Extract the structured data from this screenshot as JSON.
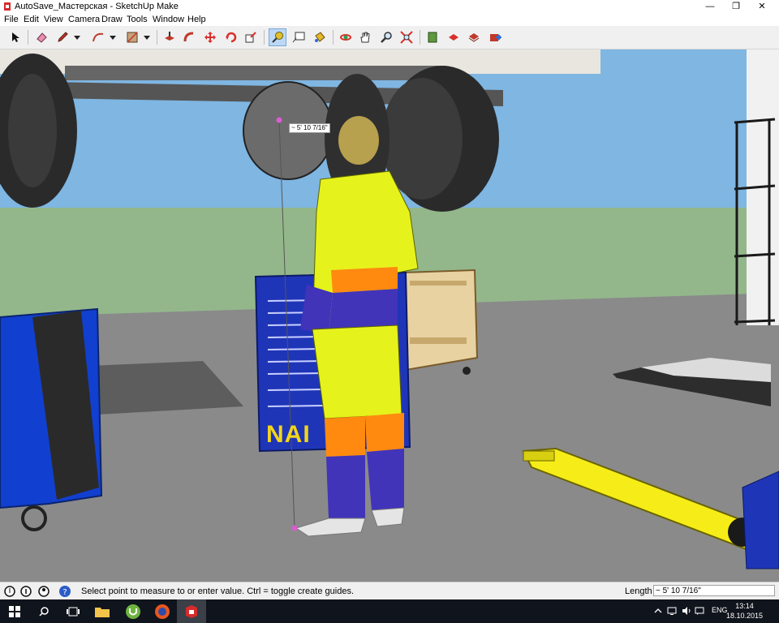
{
  "window": {
    "title": "AutoSave_Мастерская - SketchUp Make",
    "min": "—",
    "max": "❐",
    "close": "✕"
  },
  "menu": [
    "File",
    "Edit",
    "View",
    "Camera",
    "Draw",
    "Tools",
    "Window",
    "Help"
  ],
  "toolbar": {
    "tools": [
      "select-icon",
      "eraser-icon",
      "pencil-icon",
      "dropdown-icon",
      "arc-icon",
      "dropdown-icon",
      "shape-icon",
      "dropdown-icon",
      "push-pull-icon",
      "follow-me-icon",
      "move-icon",
      "rotate-icon",
      "scale-icon",
      "tape-measure-icon",
      "text-icon",
      "paint-bucket-icon",
      "orbit-icon",
      "pan-icon",
      "zoom-icon",
      "zoom-extents-icon",
      "warehouse-icon",
      "extension-icon",
      "component-icon",
      "send-icon"
    ]
  },
  "viewport": {
    "measure_tip": "~ 5' 10 7/16\"",
    "toolbox_text": "NAI"
  },
  "status": {
    "message": "Select point to measure to or enter value.  Ctrl = toggle create guides.",
    "length_label": "Length",
    "length_value": "~ 5' 10 7/16\""
  },
  "taskbar": {
    "lang": "ENG",
    "time": "13:14",
    "date": "18.10.2015",
    "apps": [
      "windows-start-icon",
      "search-icon",
      "task-view-icon",
      "file-explorer-icon",
      "utorrent-icon",
      "firefox-icon",
      "sketchup-icon"
    ]
  },
  "colors": {
    "sky": "#7fb6e2",
    "floor": "#8a8a8a",
    "grass": "#93b78b",
    "accent": "#3b7dd8"
  }
}
